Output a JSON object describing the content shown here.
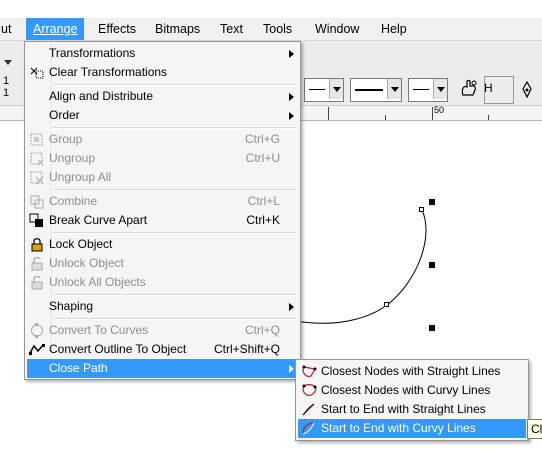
{
  "menubar": {
    "items": [
      {
        "label": "ut"
      },
      {
        "label": "Arrange"
      },
      {
        "label": "Effects"
      },
      {
        "label": "Bitmaps"
      },
      {
        "label": "Text"
      },
      {
        "label": "Tools"
      },
      {
        "label": "Window"
      },
      {
        "label": "Help"
      }
    ]
  },
  "toolbar": {
    "left_values": [
      "1",
      "1"
    ],
    "icons": [
      "hand-node-icon",
      "pen-nib-icon"
    ],
    "hint_text": "H"
  },
  "ruler": {
    "label_50": "50"
  },
  "arrange_menu": {
    "items": [
      {
        "label": "Transformations",
        "shortcut": "",
        "submenu": true,
        "disabled": false
      },
      {
        "label": "Clear Transformations",
        "shortcut": "",
        "submenu": false,
        "disabled": false
      },
      {
        "label": "Align and Distribute",
        "shortcut": "",
        "submenu": true,
        "disabled": false
      },
      {
        "label": "Order",
        "shortcut": "",
        "submenu": true,
        "disabled": false
      },
      {
        "label": "Group",
        "shortcut": "Ctrl+G",
        "submenu": false,
        "disabled": true
      },
      {
        "label": "Ungroup",
        "shortcut": "Ctrl+U",
        "submenu": false,
        "disabled": true
      },
      {
        "label": "Ungroup All",
        "shortcut": "",
        "submenu": false,
        "disabled": true
      },
      {
        "label": "Combine",
        "shortcut": "Ctrl+L",
        "submenu": false,
        "disabled": true
      },
      {
        "label": "Break Curve Apart",
        "shortcut": "Ctrl+K",
        "submenu": false,
        "disabled": false
      },
      {
        "label": "Lock Object",
        "shortcut": "",
        "submenu": false,
        "disabled": false
      },
      {
        "label": "Unlock Object",
        "shortcut": "",
        "submenu": false,
        "disabled": true
      },
      {
        "label": "Unlock All Objects",
        "shortcut": "",
        "submenu": false,
        "disabled": true
      },
      {
        "label": "Shaping",
        "shortcut": "",
        "submenu": true,
        "disabled": false
      },
      {
        "label": "Convert To Curves",
        "shortcut": "Ctrl+Q",
        "submenu": false,
        "disabled": true
      },
      {
        "label": "Convert Outline To Object",
        "shortcut": "Ctrl+Shift+Q",
        "submenu": false,
        "disabled": false
      },
      {
        "label": "Close Path",
        "shortcut": "",
        "submenu": true,
        "disabled": false,
        "highlighted": true
      }
    ]
  },
  "close_path_submenu": {
    "items": [
      {
        "label": "Closest Nodes with Straight Lines"
      },
      {
        "label": "Closest Nodes with Curvy Lines"
      },
      {
        "label": "Start to End with Straight Lines"
      },
      {
        "label": "Start to End with Curvy Lines",
        "highlighted": true
      }
    ]
  },
  "tooltip": {
    "text": "Cl"
  },
  "colors": {
    "highlight": "#3399ff",
    "menu_bg": "#f5f5f5",
    "disabled_text": "#8d8d8d"
  }
}
